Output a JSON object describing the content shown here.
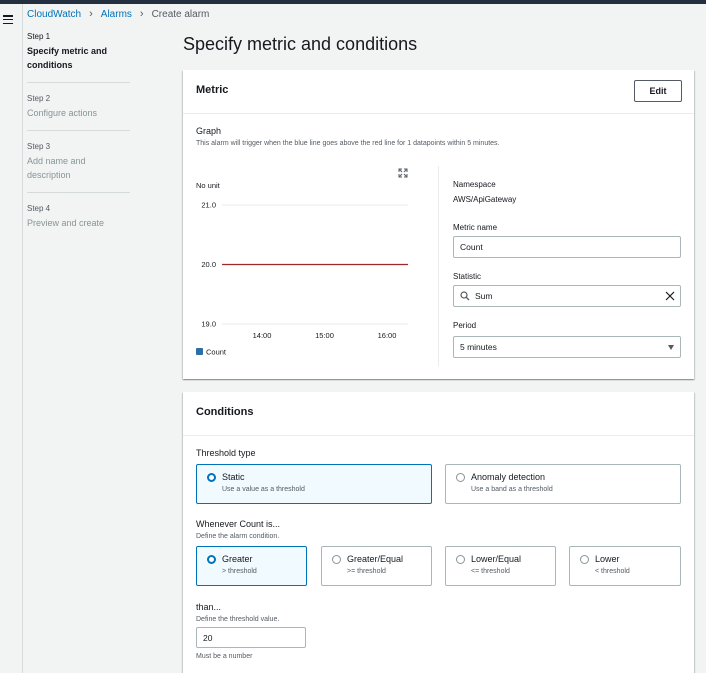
{
  "nav": {
    "menu_icon": "hamburger-menu-icon"
  },
  "breadcrumb": {
    "items": [
      "CloudWatch",
      "Alarms"
    ],
    "current": "Create alarm"
  },
  "steps": [
    {
      "num": "Step 1",
      "title": "Specify metric and conditions",
      "active": true
    },
    {
      "num": "Step 2",
      "title": "Configure actions",
      "active": false
    },
    {
      "num": "Step 3",
      "title": "Add name and description",
      "active": false
    },
    {
      "num": "Step 4",
      "title": "Preview and create",
      "active": false
    }
  ],
  "page": {
    "title": "Specify metric and conditions"
  },
  "metric": {
    "header": "Metric",
    "edit_label": "Edit",
    "graph_label": "Graph",
    "graph_desc": "This alarm will trigger when the blue line goes above the red line for 1 datapoints within 5 minutes.",
    "namespace_label": "Namespace",
    "namespace_value": "AWS/ApiGateway",
    "metric_name_label": "Metric name",
    "metric_name_value": "Count",
    "statistic_label": "Statistic",
    "statistic_value": "Sum",
    "period_label": "Period",
    "period_value": "5 minutes"
  },
  "chart_data": {
    "type": "line",
    "ylabel": "No unit",
    "ylim": [
      19.0,
      21.0
    ],
    "yticks": [
      "21.0",
      "20.0",
      "19.0"
    ],
    "xticks": [
      "14:00",
      "15:00",
      "16:00"
    ],
    "threshold": 20.0,
    "threshold_color": "#a0272b",
    "legend": [
      {
        "name": "Count",
        "color": "#2e6ea6"
      }
    ]
  },
  "conditions": {
    "header": "Conditions",
    "threshold_type_label": "Threshold type",
    "threshold_types": [
      {
        "title": "Static",
        "desc": "Use a value as a threshold",
        "selected": true
      },
      {
        "title": "Anomaly detection",
        "desc": "Use a band as a threshold",
        "selected": false
      }
    ],
    "whenever_label": "Whenever Count is...",
    "whenever_desc": "Define the alarm condition.",
    "operators": [
      {
        "title": "Greater",
        "desc": "> threshold",
        "selected": true
      },
      {
        "title": "Greater/Equal",
        "desc": ">= threshold",
        "selected": false
      },
      {
        "title": "Lower/Equal",
        "desc": "<= threshold",
        "selected": false
      },
      {
        "title": "Lower",
        "desc": "< threshold",
        "selected": false
      }
    ],
    "than_label": "than...",
    "than_desc": "Define the threshold value.",
    "threshold_value": "20",
    "threshold_hint": "Must be a number"
  },
  "colors": {
    "link": "#0073bb",
    "selected_border": "#0073bb",
    "selected_bg": "#f1faff"
  }
}
